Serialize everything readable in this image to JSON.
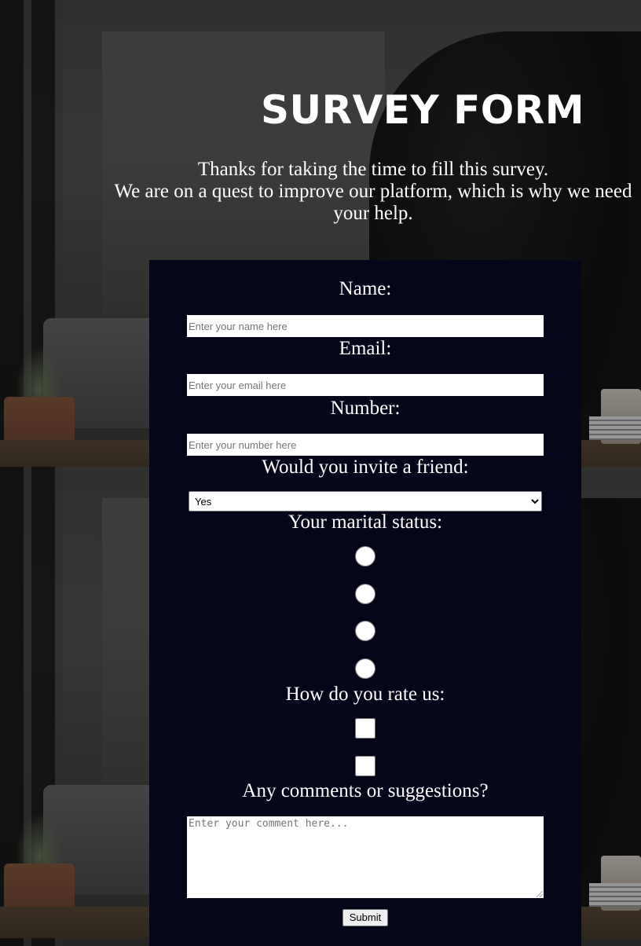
{
  "header": {
    "title": "SURVEY FORM",
    "intro_line1": "Thanks for taking the time to fill this survey.",
    "intro_line2": "We are on a quest to improve our platform, which is why we need your help."
  },
  "form": {
    "name": {
      "label": "Name:",
      "placeholder": "Enter your name here"
    },
    "email": {
      "label": "Email:",
      "placeholder": "Enter your email here"
    },
    "number": {
      "label": "Number:",
      "placeholder": "Enter your number here"
    },
    "invite": {
      "label": "Would you invite a friend:",
      "selected": "Yes"
    },
    "marital": {
      "label": "Your marital status:",
      "option_count": 4
    },
    "rating": {
      "label": "How do you rate us:",
      "option_count": 2
    },
    "comments": {
      "label": "Any comments or suggestions?",
      "placeholder": "Enter your comment here..."
    },
    "submit_label": "Submit"
  },
  "colors": {
    "panel_background": "#06061a",
    "text": "#ffffff"
  }
}
